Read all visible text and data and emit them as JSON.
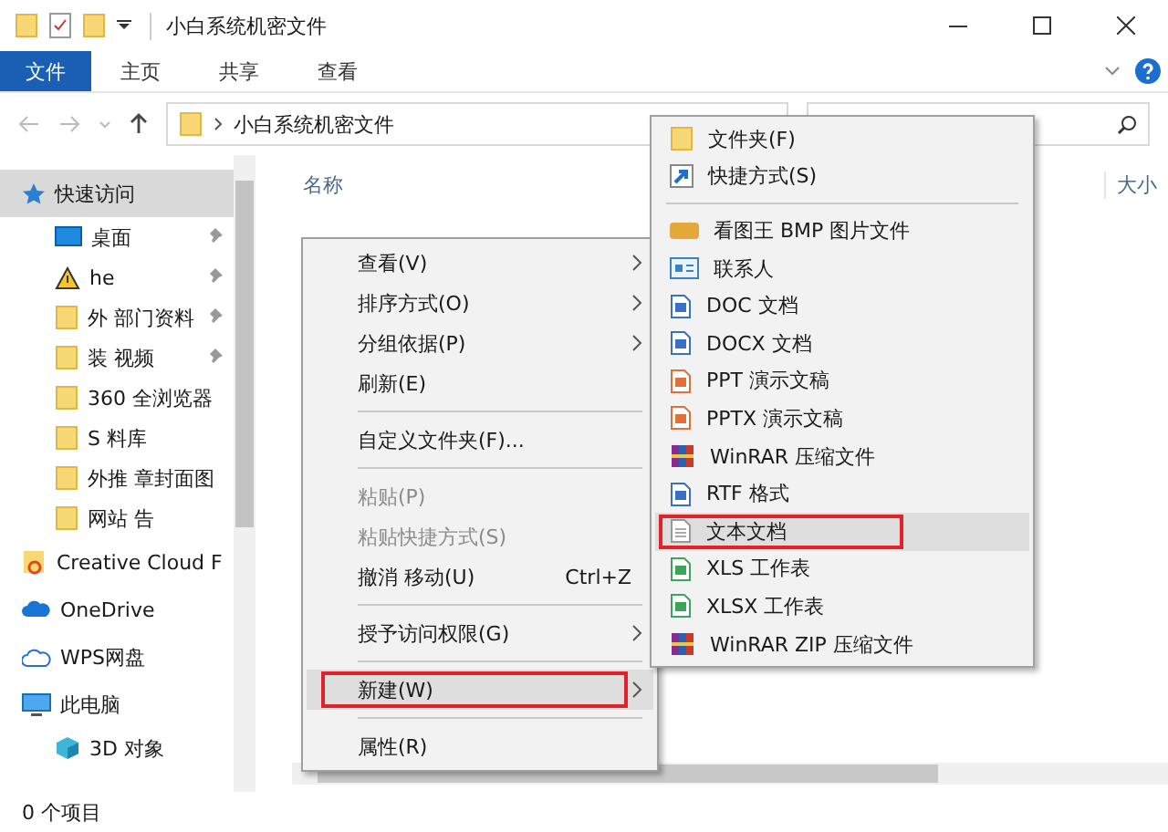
{
  "window": {
    "title": "小白系统机密文件"
  },
  "ribbon_tabs": [
    {
      "label": "文件",
      "selected": true
    },
    {
      "label": "主页",
      "selected": false
    },
    {
      "label": "共享",
      "selected": false
    },
    {
      "label": "查看",
      "selected": false
    }
  ],
  "address": {
    "path": "小白系统机密文件"
  },
  "sidebar": [
    {
      "label": "快速访问",
      "kind": "star",
      "selected": true,
      "children": [
        {
          "label": "桌面",
          "kind": "desktop",
          "pinned": true
        },
        {
          "label": "he",
          "kind": "warning",
          "pinned": true
        },
        {
          "label": "外 部门资料",
          "kind": "folder",
          "pinned": true
        },
        {
          "label": "装 视频",
          "kind": "folder",
          "pinned": true
        },
        {
          "label": "360 全浏览器",
          "kind": "folder",
          "pinned": false
        },
        {
          "label": "S 料库",
          "kind": "folder",
          "pinned": false
        },
        {
          "label": "外推 章封面图",
          "kind": "folder",
          "pinned": false
        },
        {
          "label": "网站 告",
          "kind": "folder",
          "pinned": false
        }
      ]
    },
    {
      "label": "Creative Cloud F",
      "kind": "cc",
      "selected": false
    },
    {
      "label": "OneDrive",
      "kind": "cloud",
      "selected": false
    },
    {
      "label": "WPS网盘",
      "kind": "cloudoutline",
      "selected": false
    },
    {
      "label": "此电脑",
      "kind": "pc",
      "selected": false,
      "children": [
        {
          "label": "3D 对象",
          "kind": "cube",
          "pinned": false
        }
      ]
    }
  ],
  "columns": [
    "名称",
    "大小"
  ],
  "context_menu": [
    {
      "kind": "item",
      "label": "查看(V)",
      "submenu": true,
      "disabled": false,
      "selected": false
    },
    {
      "kind": "item",
      "label": "排序方式(O)",
      "submenu": true,
      "disabled": false,
      "selected": false
    },
    {
      "kind": "item",
      "label": "分组依据(P)",
      "submenu": true,
      "disabled": false,
      "selected": false
    },
    {
      "kind": "item",
      "label": "刷新(E)",
      "submenu": false,
      "disabled": false,
      "selected": false
    },
    {
      "kind": "separator"
    },
    {
      "kind": "item",
      "label": "自定义文件夹(F)...",
      "submenu": false,
      "disabled": false,
      "selected": false
    },
    {
      "kind": "separator"
    },
    {
      "kind": "item",
      "label": "粘贴(P)",
      "submenu": false,
      "disabled": true,
      "selected": false
    },
    {
      "kind": "item",
      "label": "粘贴快捷方式(S)",
      "submenu": false,
      "disabled": true,
      "selected": false
    },
    {
      "kind": "item",
      "label": "撤消 移动(U)",
      "shortcut": "Ctrl+Z",
      "submenu": false,
      "disabled": false,
      "selected": false
    },
    {
      "kind": "separator"
    },
    {
      "kind": "item",
      "label": "授予访问权限(G)",
      "submenu": true,
      "disabled": false,
      "selected": false
    },
    {
      "kind": "separator"
    },
    {
      "kind": "item",
      "label": "新建(W)",
      "submenu": true,
      "disabled": false,
      "selected": true
    },
    {
      "kind": "separator"
    },
    {
      "kind": "item",
      "label": "属性(R)",
      "submenu": false,
      "disabled": false,
      "selected": false
    }
  ],
  "new_submenu": [
    {
      "kind": "folder",
      "label": "文件夹(F)",
      "selected": false
    },
    {
      "kind": "shortcut",
      "label": "快捷方式(S)",
      "selected": false
    },
    {
      "kind": "separator"
    },
    {
      "kind": "bmp",
      "label": "看图王 BMP 图片文件",
      "selected": false
    },
    {
      "kind": "contact",
      "label": "联系人",
      "selected": false
    },
    {
      "kind": "doc",
      "label": "DOC 文档",
      "selected": false
    },
    {
      "kind": "docx",
      "label": "DOCX 文档",
      "selected": false
    },
    {
      "kind": "ppt",
      "label": "PPT 演示文稿",
      "selected": false
    },
    {
      "kind": "pptx",
      "label": "PPTX 演示文稿",
      "selected": false
    },
    {
      "kind": "rar",
      "label": "WinRAR 压缩文件",
      "selected": false
    },
    {
      "kind": "rtf",
      "label": "RTF 格式",
      "selected": false
    },
    {
      "kind": "txt",
      "label": "文本文档",
      "selected": true
    },
    {
      "kind": "xls",
      "label": "XLS 工作表",
      "selected": false
    },
    {
      "kind": "xlsx",
      "label": "XLSX 工作表",
      "selected": false
    },
    {
      "kind": "zip",
      "label": "WinRAR ZIP 压缩文件",
      "selected": false
    }
  ],
  "status_bar": {
    "text": "0 个项目"
  }
}
